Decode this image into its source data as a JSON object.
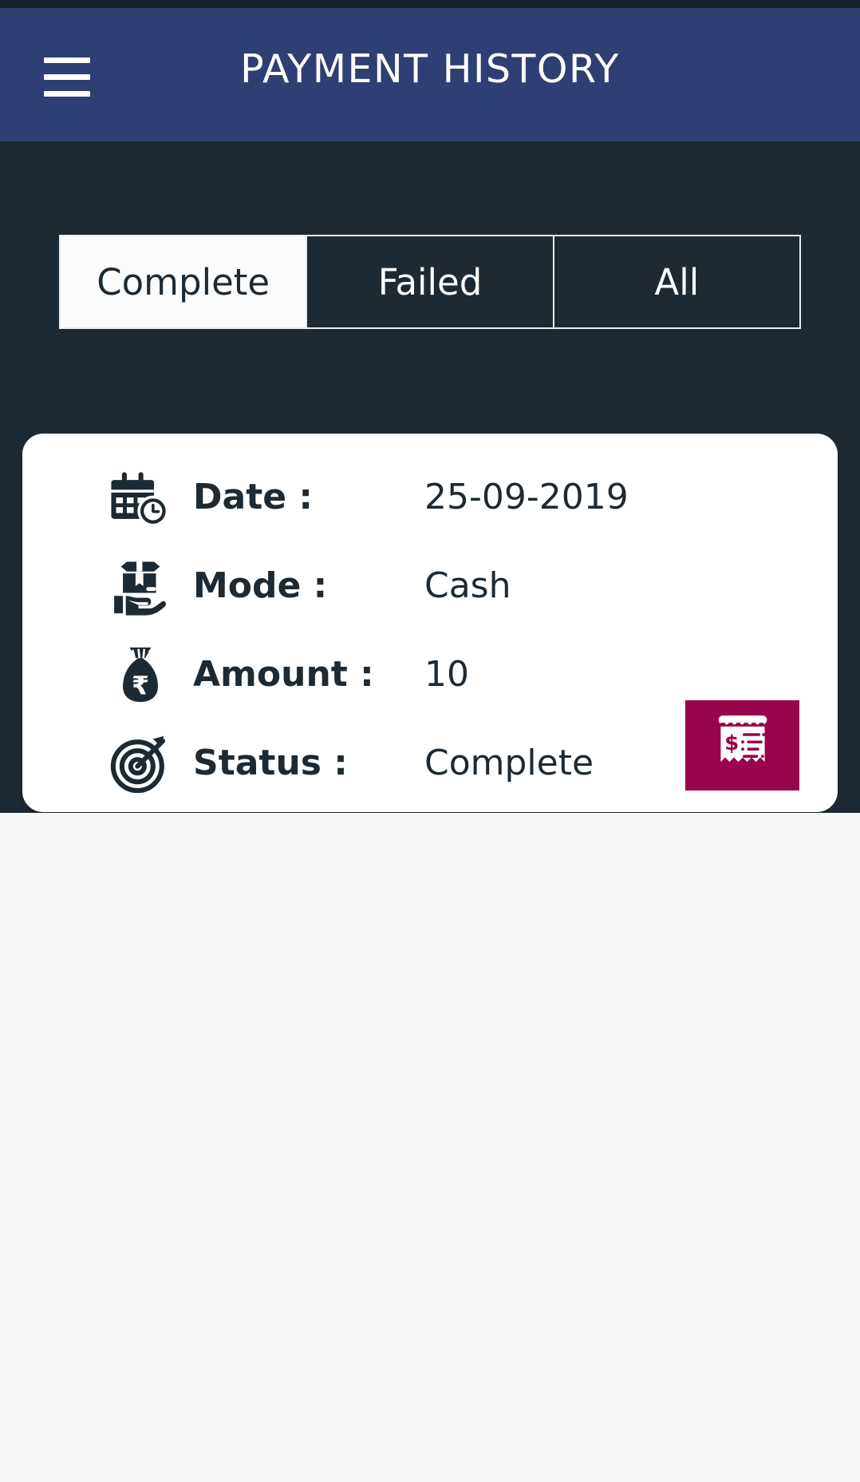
{
  "header": {
    "title": "PAYMENT HISTORY",
    "menu_icon": "hamburger-menu-icon",
    "background_color": "#2e3f73"
  },
  "tabs": {
    "items": [
      {
        "label": "Complete",
        "active": true
      },
      {
        "label": "Failed",
        "active": false
      },
      {
        "label": "All",
        "active": false
      }
    ]
  },
  "card": {
    "rows": [
      {
        "icon": "calendar-clock-icon",
        "label": "Date :",
        "value": "25-09-2019"
      },
      {
        "icon": "hand-package-icon",
        "label": "Mode :",
        "value": "Cash"
      },
      {
        "icon": "money-bag-rupee-icon",
        "label": "Amount :",
        "value": "10"
      },
      {
        "icon": "target-dart-icon",
        "label": "Status :",
        "value": "Complete"
      }
    ],
    "receipt_button": {
      "icon": "receipt-dollar-icon",
      "background_color": "#98054a"
    }
  },
  "theme": {
    "body_background": "#1e2a33",
    "page_background": "#f7f8f8",
    "accent": "#98054a",
    "text_dark": "#1d2a33",
    "text_light": "#ffffff"
  }
}
